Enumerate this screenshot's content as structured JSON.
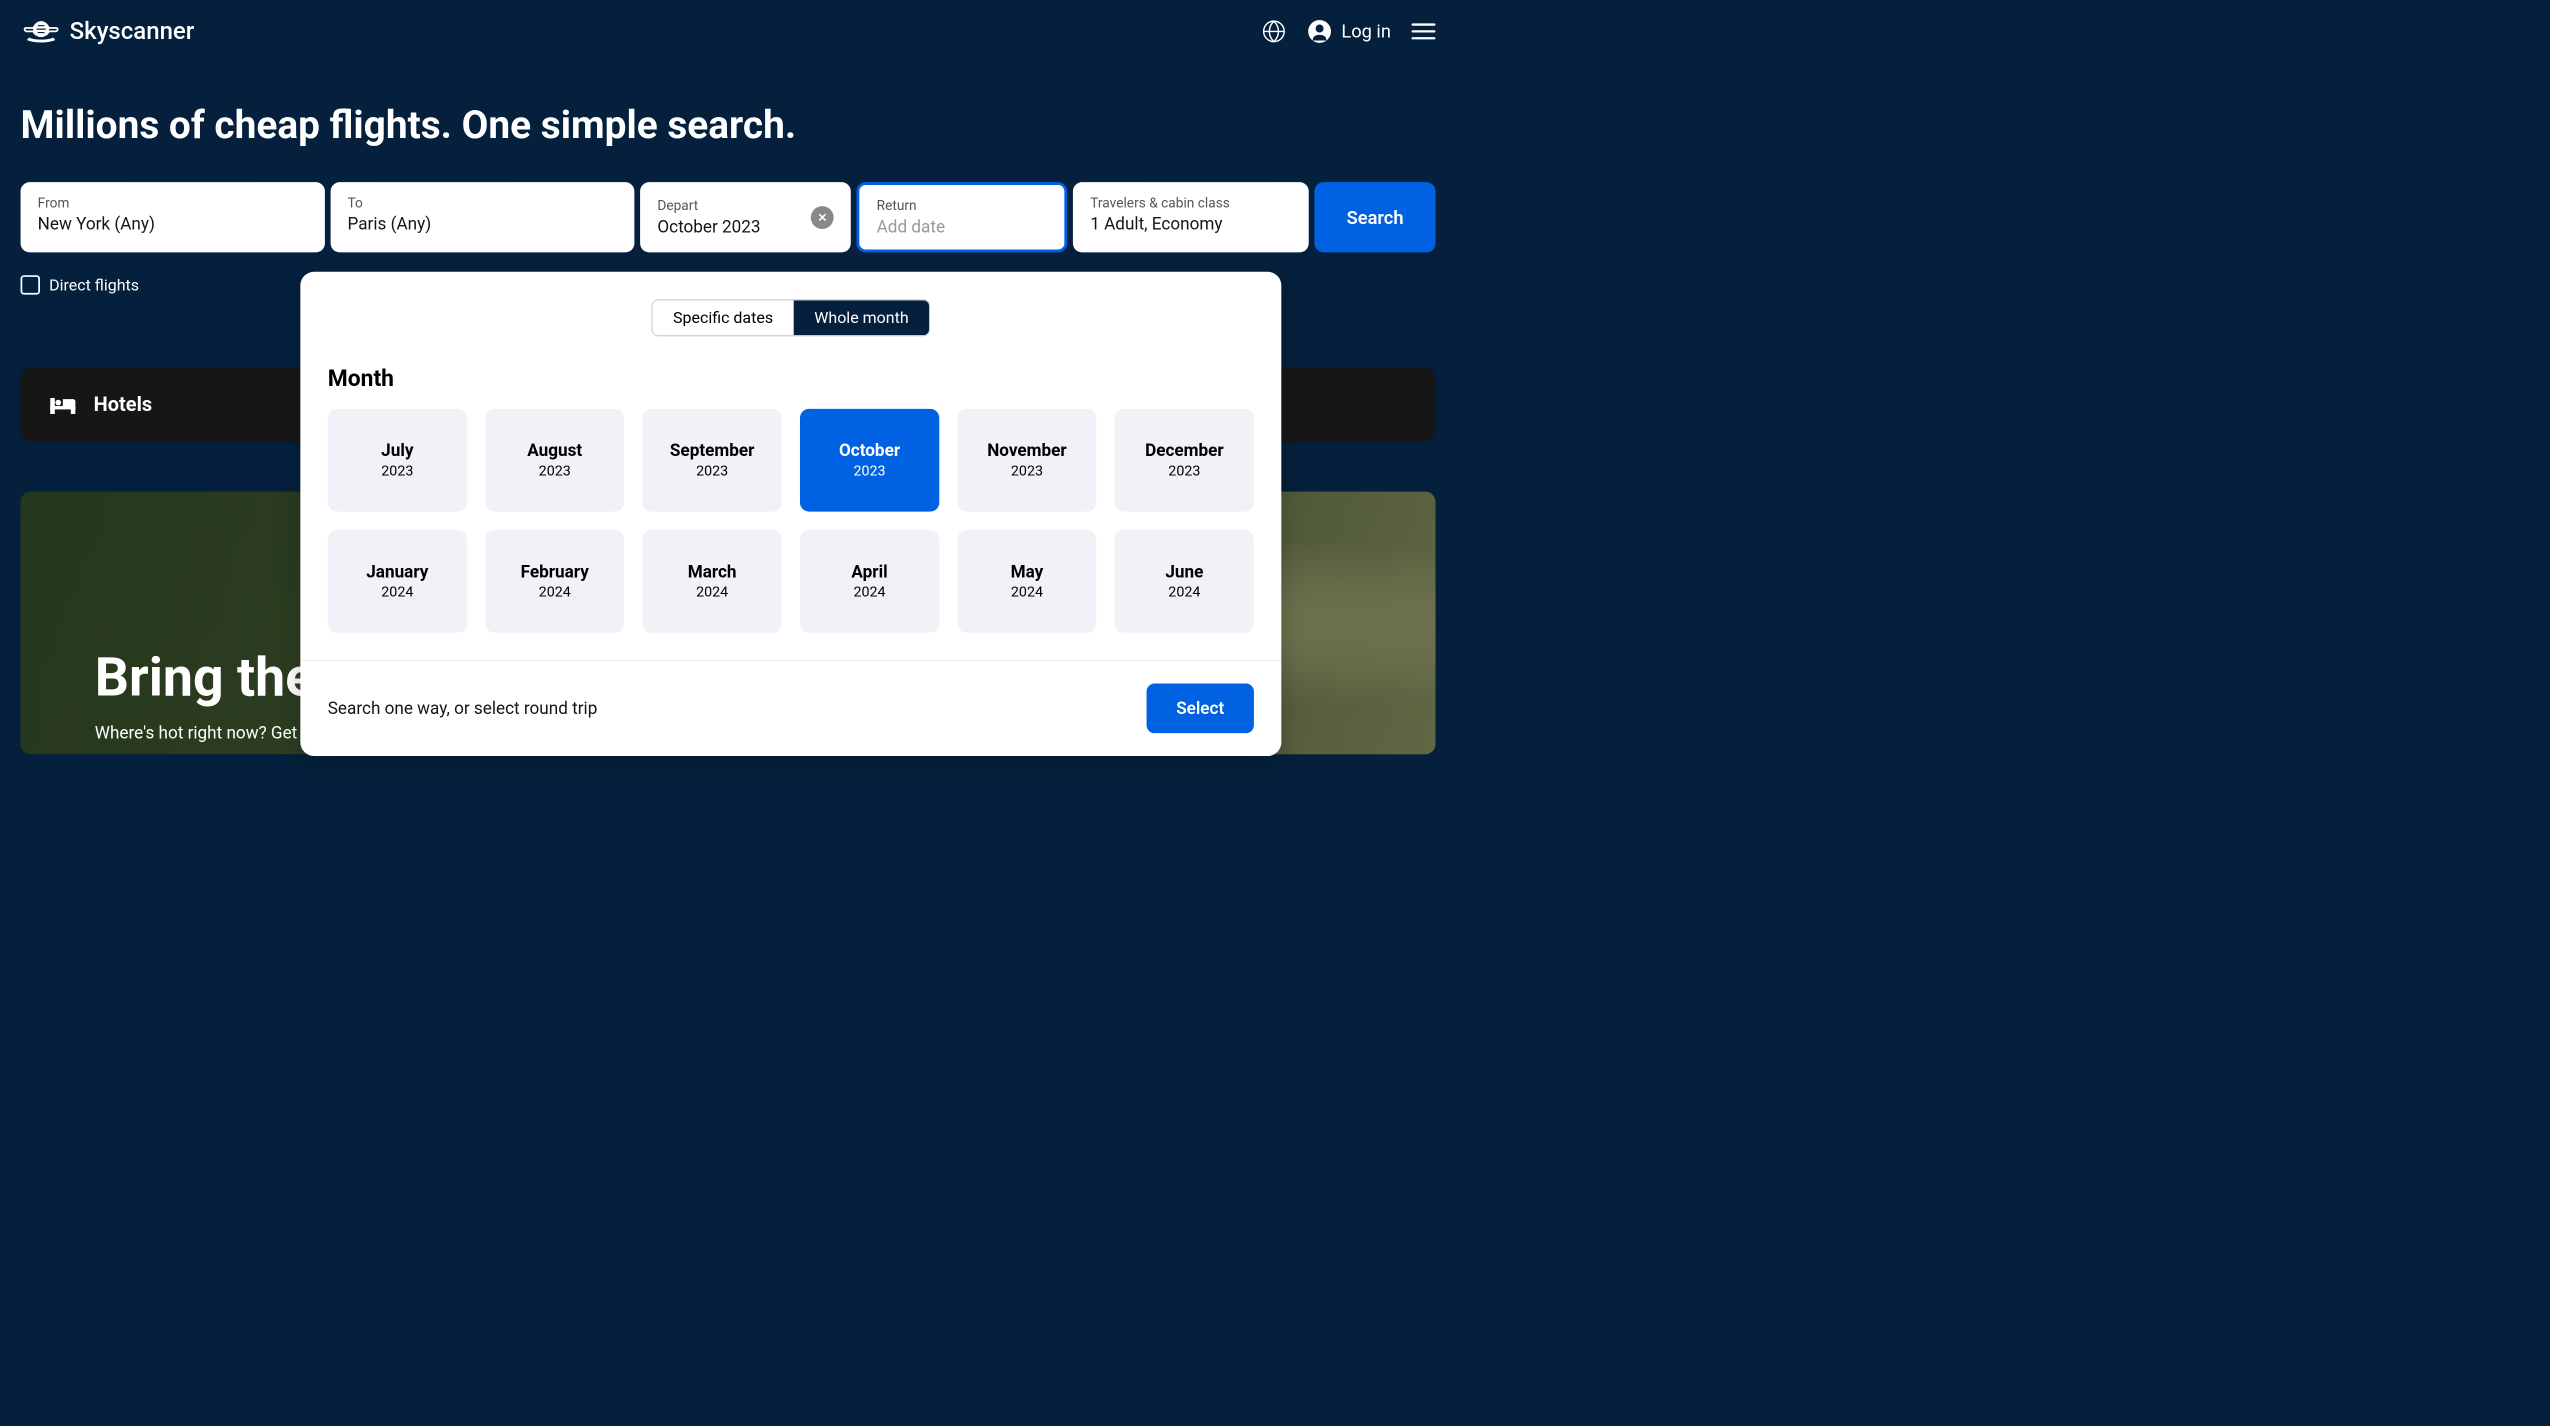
{
  "brand": "Skyscanner",
  "header": {
    "login_label": "Log in"
  },
  "hero_title": "Millions of cheap flights. One simple search.",
  "search": {
    "from_label": "From",
    "from_value": "New York (Any)",
    "to_label": "To",
    "to_value": "Paris (Any)",
    "depart_label": "Depart",
    "depart_value": "October 2023",
    "return_label": "Return",
    "return_placeholder": "Add date",
    "travelers_label": "Travelers & cabin class",
    "travelers_value": "1 Adult, Economy",
    "search_button": "Search",
    "direct_flights_label": "Direct flights"
  },
  "datepicker": {
    "tab_specific": "Specific dates",
    "tab_whole": "Whole month",
    "month_title": "Month",
    "months": [
      {
        "name": "July",
        "year": "2023",
        "selected": false
      },
      {
        "name": "August",
        "year": "2023",
        "selected": false
      },
      {
        "name": "September",
        "year": "2023",
        "selected": false
      },
      {
        "name": "October",
        "year": "2023",
        "selected": true
      },
      {
        "name": "November",
        "year": "2023",
        "selected": false
      },
      {
        "name": "December",
        "year": "2023",
        "selected": false
      },
      {
        "name": "January",
        "year": "2024",
        "selected": false
      },
      {
        "name": "February",
        "year": "2024",
        "selected": false
      },
      {
        "name": "March",
        "year": "2024",
        "selected": false
      },
      {
        "name": "April",
        "year": "2024",
        "selected": false
      },
      {
        "name": "May",
        "year": "2024",
        "selected": false
      },
      {
        "name": "June",
        "year": "2024",
        "selected": false
      }
    ],
    "footer_text": "Search one way, or select round trip",
    "select_button": "Select"
  },
  "hotels": {
    "label": "Hotels"
  },
  "promo": {
    "title": "Bring the",
    "subtitle": "Where's hot right now? Get some sun on your skin"
  }
}
